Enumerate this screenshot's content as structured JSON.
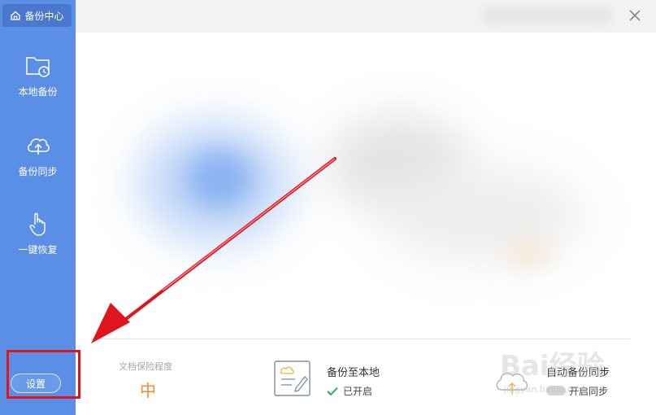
{
  "sidebar": {
    "brand_label": "备份中心",
    "items": [
      {
        "label": "本地备份",
        "icon": "folder-clock-icon"
      },
      {
        "label": "备份同步",
        "icon": "cloud-upload-icon"
      },
      {
        "label": "一键恢复",
        "icon": "hand-pointer-icon"
      }
    ],
    "settings_label": "设置"
  },
  "bottom": {
    "protection_label": "文档保险程度",
    "protection_value": "中",
    "local_backup_title": "备份至本地",
    "local_backup_status": "已开启",
    "sync_title": "自动备份同步",
    "sync_status": "开启同步"
  },
  "watermark": {
    "text": "Bai经验",
    "sub": "jingyan.baidu.com"
  },
  "colors": {
    "sidebar": "#5b8fe6",
    "annotation": "#e0141c",
    "accent_orange": "#f08a3c",
    "check_green": "#3aa655"
  }
}
